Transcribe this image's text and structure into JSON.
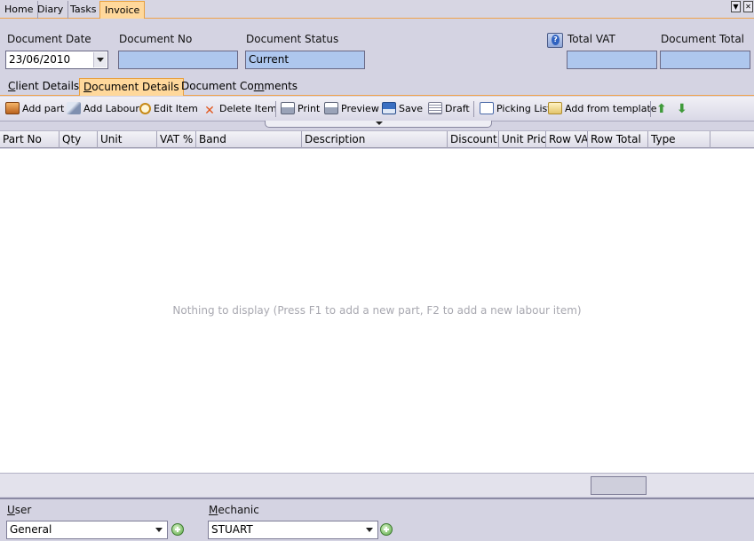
{
  "top_tabs": [
    {
      "label": "Home"
    },
    {
      "label": "Diary"
    },
    {
      "label": "Tasks"
    },
    {
      "label": "Invoice"
    }
  ],
  "header": {
    "document_date": {
      "label": "Document Date",
      "value": "23/06/2010"
    },
    "document_no": {
      "label": "Document No",
      "value": ""
    },
    "document_status": {
      "label": "Document Status",
      "value": "Current"
    },
    "total_vat": {
      "label": "Total VAT",
      "value": ""
    },
    "document_total": {
      "label": "Document Total",
      "value": ""
    }
  },
  "sub_tabs": [
    {
      "label_pre": "",
      "label_u": "C",
      "label_post": "lient Details"
    },
    {
      "label_pre": "",
      "label_u": "D",
      "label_post": "ocument Details"
    },
    {
      "label_pre": "Document Co",
      "label_u": "m",
      "label_post": "ments"
    }
  ],
  "toolbar": {
    "add_part": "Add part",
    "add_labour": "Add Labour",
    "edit_item": "Edit Item",
    "delete_item": "Delete Item",
    "print": "Print",
    "preview": "Preview",
    "save": "Save",
    "draft": "Draft",
    "picking_list": "Picking List",
    "add_from_template": "Add from template"
  },
  "grid": {
    "columns": [
      "Part No",
      "Qty",
      "Unit",
      "VAT %",
      "Band",
      "Description",
      "Discount",
      "Unit Pric",
      "Row VA",
      "Row Total",
      "Type"
    ],
    "empty_text": "Nothing to display (Press F1 to add a new part, F2 to add a new labour item)"
  },
  "footer": {
    "user": {
      "label": "User",
      "value": "General"
    },
    "mechanic": {
      "label": "Mechanic",
      "value": "STUART"
    }
  },
  "colors": {
    "accent": "#f0a24b",
    "active_tab": "#ffd89b",
    "field_fill": "#aec7ee",
    "panel": "#d4d3e2"
  }
}
